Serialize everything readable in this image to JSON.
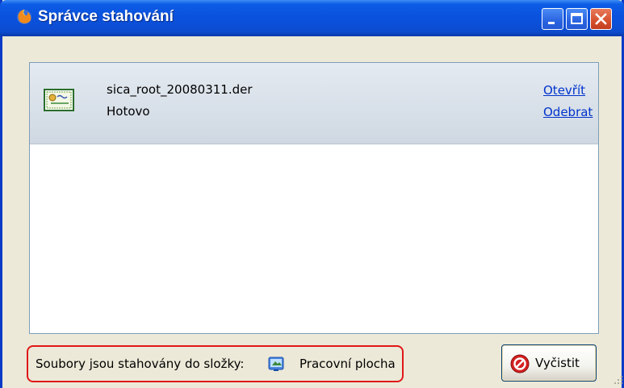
{
  "window": {
    "title": "Správce stahování",
    "title_icon": "firefox-icon",
    "controls": [
      "minimize",
      "maximize",
      "close"
    ]
  },
  "downloads": [
    {
      "file_name": "sica_root_20080311.der",
      "status": "Hotovo",
      "icon": "certificate-file-icon",
      "actions": {
        "open": "Otevřít",
        "remove": "Odebrat"
      }
    }
  ],
  "footer": {
    "folder_label": "Soubory jsou stahovány do složky:",
    "folder_name": "Pracovní plocha",
    "folder_icon": "desktop-folder-icon",
    "highlight_color": "#e01818",
    "clear_button": {
      "label": "Vyčistit",
      "icon": "no-entry-icon"
    }
  },
  "colors": {
    "titlebar": "#0a52de",
    "close_button": "#d6502e",
    "link": "#0033cc",
    "item_background": "#dde4ec"
  }
}
